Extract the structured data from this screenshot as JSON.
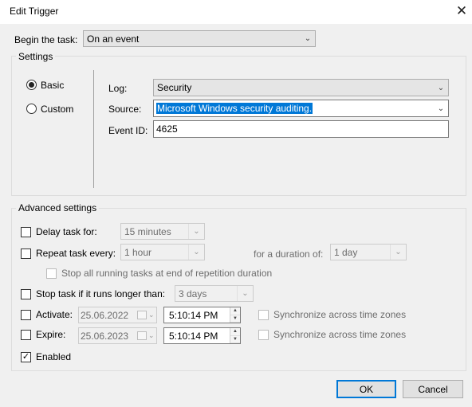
{
  "window": {
    "title": "Edit Trigger",
    "close_glyph": "✕"
  },
  "begin_task": {
    "label": "Begin the task:",
    "value": "On an event"
  },
  "settings": {
    "group_label": "Settings",
    "radio_basic": "Basic",
    "radio_custom": "Custom",
    "selected_mode": "Basic",
    "log_label": "Log:",
    "log_value": "Security",
    "source_label": "Source:",
    "source_value": "Microsoft Windows security auditing.",
    "event_id_label": "Event ID:",
    "event_id_value": "4625"
  },
  "advanced": {
    "group_label": "Advanced settings",
    "delay_label": "Delay task for:",
    "delay_checked": false,
    "delay_value": "15 minutes",
    "repeat_label": "Repeat task every:",
    "repeat_checked": false,
    "repeat_value": "1 hour",
    "duration_label": "for a duration of:",
    "duration_value": "1 day",
    "stop_all_label": "Stop all running tasks at end of repetition duration",
    "stop_longer_label": "Stop task if it runs longer than:",
    "stop_longer_checked": false,
    "stop_longer_value": "3 days",
    "activate_label": "Activate:",
    "activate_checked": false,
    "activate_date": "25.06.2022",
    "activate_time": "5:10:14 PM",
    "activate_sync_label": "Synchronize across time zones",
    "expire_label": "Expire:",
    "expire_checked": false,
    "expire_date": "25.06.2023",
    "expire_time": "5:10:14 PM",
    "expire_sync_label": "Synchronize across time zones",
    "enabled_label": "Enabled",
    "enabled_checked": true
  },
  "buttons": {
    "ok": "OK",
    "cancel": "Cancel"
  },
  "colors": {
    "selection": "#0078d7",
    "default_button_border": "#0078d7"
  }
}
